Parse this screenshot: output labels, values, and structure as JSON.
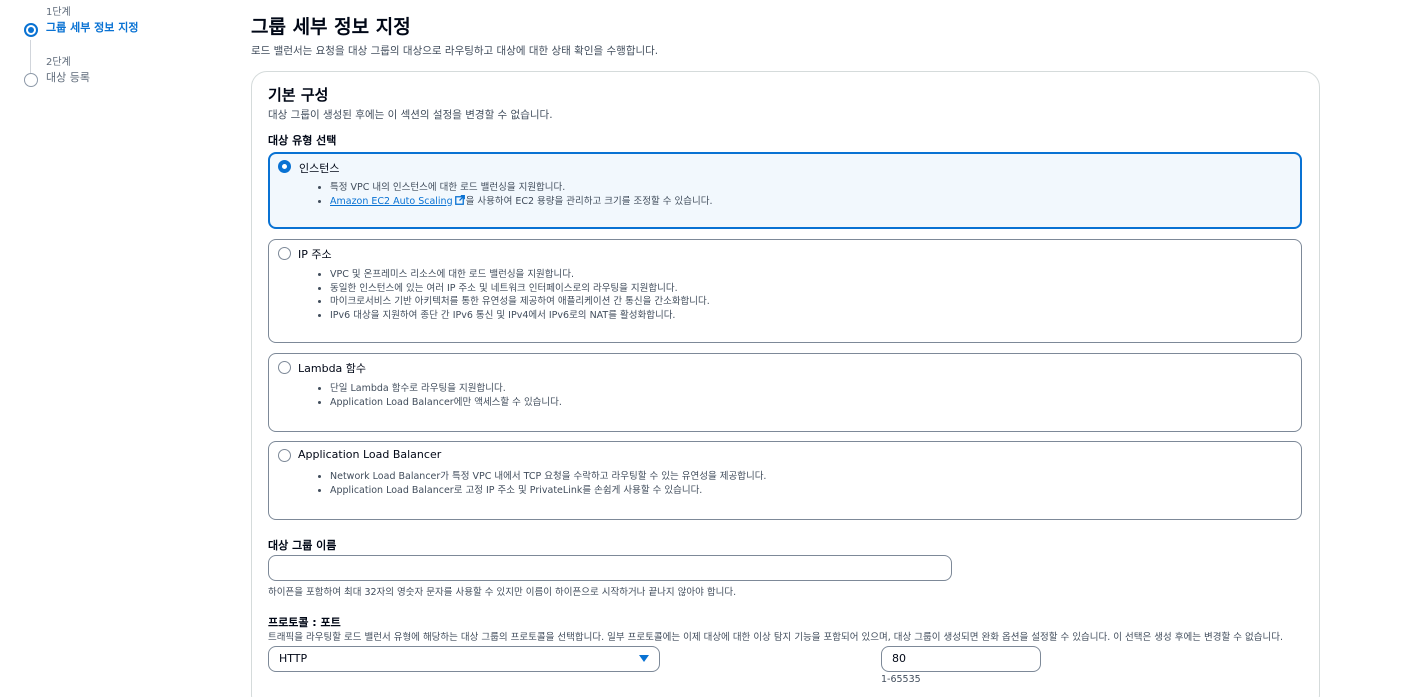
{
  "stepper": {
    "steps": [
      {
        "num": "1단계",
        "title": "그룹 세부 정보 지정"
      },
      {
        "num": "2단계",
        "title": "대상 등록"
      }
    ]
  },
  "header": {
    "title": "그룹 세부 정보 지정",
    "description": "로드 밸런서는 요청을 대상 그룹의 대상으로 라우팅하고 대상에 대한 상태 확인을 수행합니다."
  },
  "basic_config": {
    "title": "기본 구성",
    "description": "대상 그룹이 생성된 후에는 이 섹션의 설정을 변경할 수 없습니다.",
    "target_type_label": "대상 유형 선택",
    "options": [
      {
        "label": "인스턴스",
        "selected": true,
        "bullets": [
          "특정 VPC 내의 인스턴스에 대한 로드 밸런싱을 지원합니다."
        ],
        "link_text": "Amazon EC2 Auto Scaling",
        "link_suffix": "을 사용하여 EC2 용량을 관리하고 크기를 조정할 수 있습니다."
      },
      {
        "label": "IP 주소",
        "selected": false,
        "bullets": [
          "VPC 및 온프레미스 리소스에 대한 로드 밸런싱을 지원합니다.",
          "동일한 인스턴스에 있는 여러 IP 주소 및 네트워크 인터페이스로의 라우팅을 지원합니다.",
          "마이크로서비스 기반 아키텍처를 통한 유연성을 제공하여 애플리케이션 간 통신을 간소화합니다.",
          "IPv6 대상을 지원하여 종단 간 IPv6 통신 및 IPv4에서 IPv6로의 NAT를 활성화합니다."
        ]
      },
      {
        "label": "Lambda 함수",
        "selected": false,
        "bullets": [
          "단일 Lambda 함수로 라우팅을 지원합니다.",
          "Application Load Balancer에만 액세스할 수 있습니다."
        ]
      },
      {
        "label": "Application Load Balancer",
        "selected": false,
        "bullets": [
          "Network Load Balancer가 특정 VPC 내에서 TCP 요청을 수락하고 라우팅할 수 있는 유연성을 제공합니다.",
          "Application Load Balancer로 고정 IP 주소 및 PrivateLink를 손쉽게 사용할 수 있습니다."
        ]
      }
    ],
    "name_field": {
      "label": "대상 그룹 이름",
      "value": "",
      "hint": "하이픈을 포함하여 최대 32자의 영숫자 문자를 사용할 수 있지만 이름이 하이픈으로 시작하거나 끝나지 않아야 합니다."
    },
    "protocol_port": {
      "label": "프로토콜 : 포트",
      "description": "트래픽을 라우팅할 로드 밸런서 유형에 해당하는 대상 그룹의 프로토콜을 선택합니다. 일부 프로토콜에는 이제 대상에 대한 이상 탐지 기능을 포함되어 있으며, 대상 그룹이 생성되면 완화 옵션을 설정할 수 있습니다. 이 선택은 생성 후에는 변경할 수 없습니다.",
      "protocol": "HTTP",
      "port": "80",
      "port_hint": "1-65535"
    }
  },
  "colors": {
    "accent": "#0972d3",
    "selected_bg": "#f2f8fd",
    "border": "#7d8998"
  }
}
